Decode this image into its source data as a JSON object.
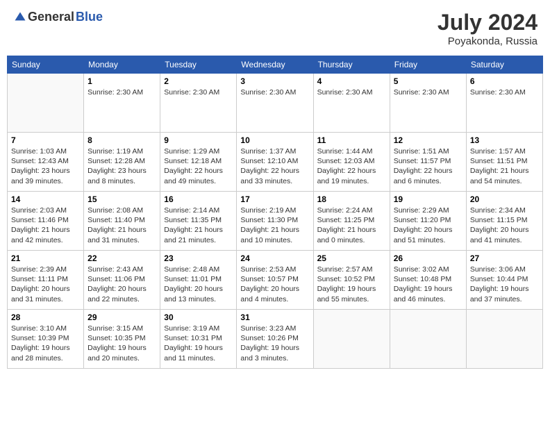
{
  "header": {
    "logo_general": "General",
    "logo_blue": "Blue",
    "month_year": "July 2024",
    "location": "Poyakonda, Russia"
  },
  "weekdays": [
    "Sunday",
    "Monday",
    "Tuesday",
    "Wednesday",
    "Thursday",
    "Friday",
    "Saturday"
  ],
  "weeks": [
    [
      {
        "day": "",
        "info": ""
      },
      {
        "day": "1",
        "info": "Sunrise: 2:30 AM"
      },
      {
        "day": "2",
        "info": "Sunrise: 2:30 AM"
      },
      {
        "day": "3",
        "info": "Sunrise: 2:30 AM"
      },
      {
        "day": "4",
        "info": "Sunrise: 2:30 AM"
      },
      {
        "day": "5",
        "info": "Sunrise: 2:30 AM"
      },
      {
        "day": "6",
        "info": "Sunrise: 2:30 AM"
      }
    ],
    [
      {
        "day": "7",
        "info": "Sunrise: 1:03 AM\nSunset: 12:43 AM\nDaylight: 23 hours and 39 minutes."
      },
      {
        "day": "8",
        "info": "Sunrise: 1:19 AM\nSunset: 12:28 AM\nDaylight: 23 hours and 8 minutes."
      },
      {
        "day": "9",
        "info": "Sunrise: 1:29 AM\nSunset: 12:18 AM\nDaylight: 22 hours and 49 minutes."
      },
      {
        "day": "10",
        "info": "Sunrise: 1:37 AM\nSunset: 12:10 AM\nDaylight: 22 hours and 33 minutes."
      },
      {
        "day": "11",
        "info": "Sunrise: 1:44 AM\nSunset: 12:03 AM\nDaylight: 22 hours and 19 minutes."
      },
      {
        "day": "12",
        "info": "Sunrise: 1:51 AM\nSunset: 11:57 PM\nDaylight: 22 hours and 6 minutes."
      },
      {
        "day": "13",
        "info": "Sunrise: 1:57 AM\nSunset: 11:51 PM\nDaylight: 21 hours and 54 minutes."
      }
    ],
    [
      {
        "day": "14",
        "info": "Sunrise: 2:03 AM\nSunset: 11:46 PM\nDaylight: 21 hours and 42 minutes."
      },
      {
        "day": "15",
        "info": "Sunrise: 2:08 AM\nSunset: 11:40 PM\nDaylight: 21 hours and 31 minutes."
      },
      {
        "day": "16",
        "info": "Sunrise: 2:14 AM\nSunset: 11:35 PM\nDaylight: 21 hours and 21 minutes."
      },
      {
        "day": "17",
        "info": "Sunrise: 2:19 AM\nSunset: 11:30 PM\nDaylight: 21 hours and 10 minutes."
      },
      {
        "day": "18",
        "info": "Sunrise: 2:24 AM\nSunset: 11:25 PM\nDaylight: 21 hours and 0 minutes."
      },
      {
        "day": "19",
        "info": "Sunrise: 2:29 AM\nSunset: 11:20 PM\nDaylight: 20 hours and 51 minutes."
      },
      {
        "day": "20",
        "info": "Sunrise: 2:34 AM\nSunset: 11:15 PM\nDaylight: 20 hours and 41 minutes."
      }
    ],
    [
      {
        "day": "21",
        "info": "Sunrise: 2:39 AM\nSunset: 11:11 PM\nDaylight: 20 hours and 31 minutes."
      },
      {
        "day": "22",
        "info": "Sunrise: 2:43 AM\nSunset: 11:06 PM\nDaylight: 20 hours and 22 minutes."
      },
      {
        "day": "23",
        "info": "Sunrise: 2:48 AM\nSunset: 11:01 PM\nDaylight: 20 hours and 13 minutes."
      },
      {
        "day": "24",
        "info": "Sunrise: 2:53 AM\nSunset: 10:57 PM\nDaylight: 20 hours and 4 minutes."
      },
      {
        "day": "25",
        "info": "Sunrise: 2:57 AM\nSunset: 10:52 PM\nDaylight: 19 hours and 55 minutes."
      },
      {
        "day": "26",
        "info": "Sunrise: 3:02 AM\nSunset: 10:48 PM\nDaylight: 19 hours and 46 minutes."
      },
      {
        "day": "27",
        "info": "Sunrise: 3:06 AM\nSunset: 10:44 PM\nDaylight: 19 hours and 37 minutes."
      }
    ],
    [
      {
        "day": "28",
        "info": "Sunrise: 3:10 AM\nSunset: 10:39 PM\nDaylight: 19 hours and 28 minutes."
      },
      {
        "day": "29",
        "info": "Sunrise: 3:15 AM\nSunset: 10:35 PM\nDaylight: 19 hours and 20 minutes."
      },
      {
        "day": "30",
        "info": "Sunrise: 3:19 AM\nSunset: 10:31 PM\nDaylight: 19 hours and 11 minutes."
      },
      {
        "day": "31",
        "info": "Sunrise: 3:23 AM\nSunset: 10:26 PM\nDaylight: 19 hours and 3 minutes."
      },
      {
        "day": "",
        "info": ""
      },
      {
        "day": "",
        "info": ""
      },
      {
        "day": "",
        "info": ""
      }
    ]
  ]
}
